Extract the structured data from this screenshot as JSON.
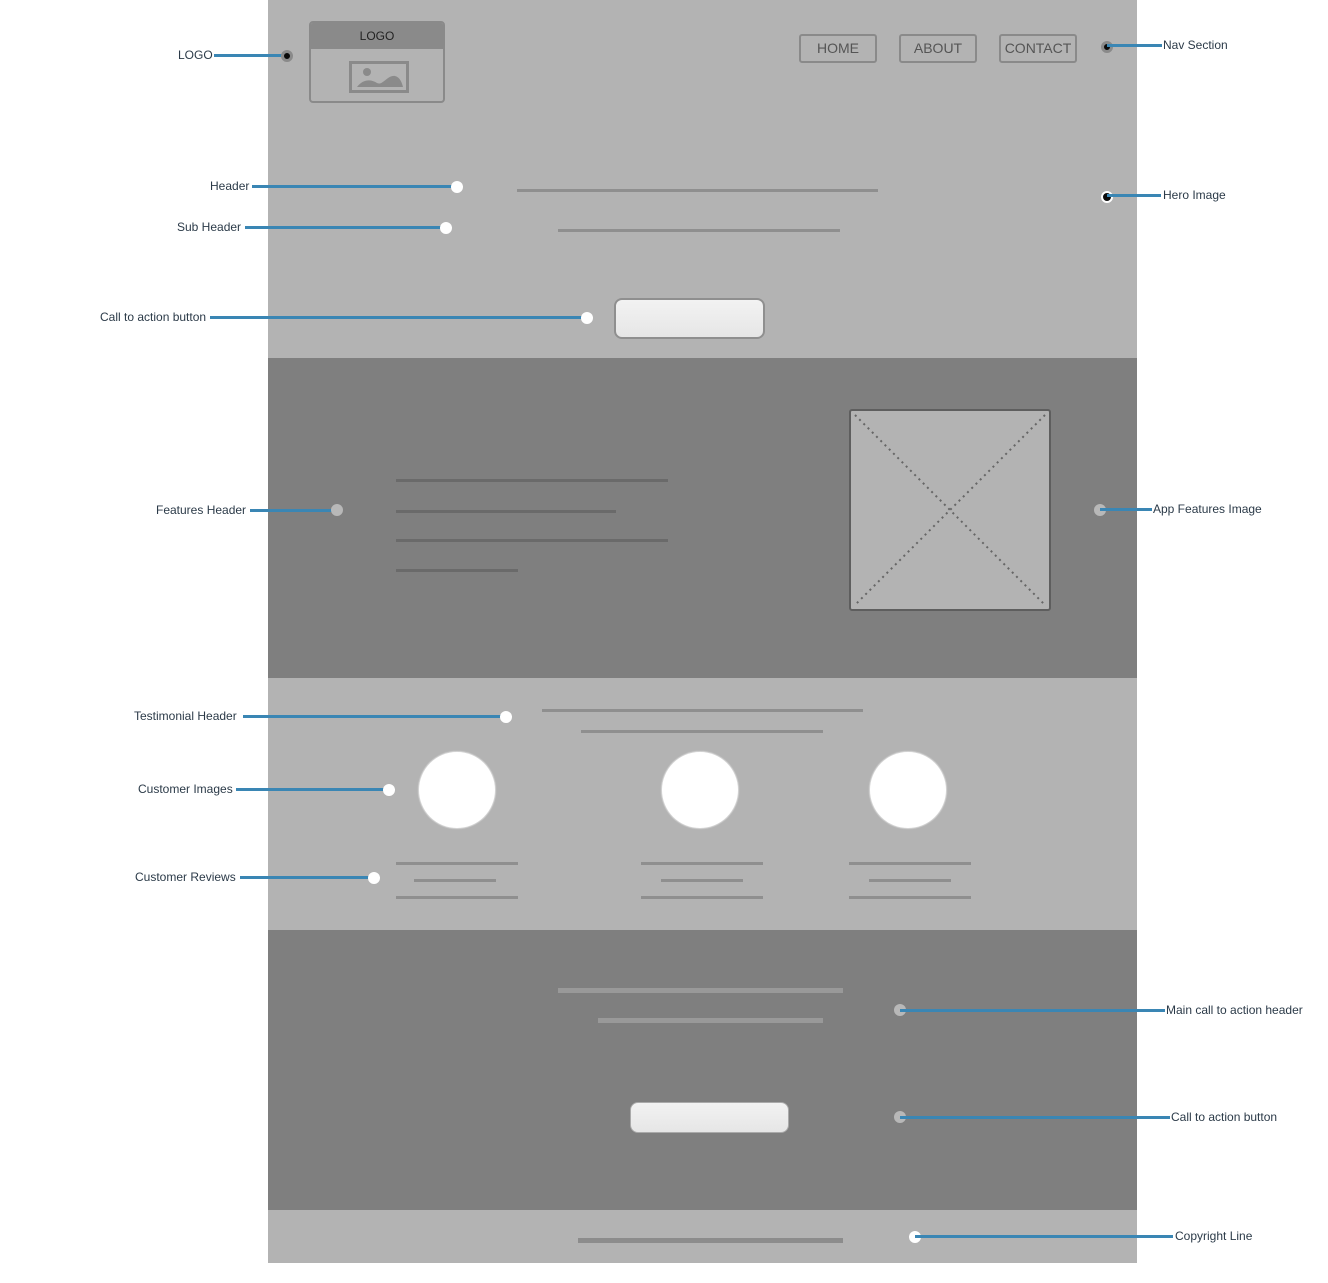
{
  "wireframe": {
    "logo_label": "LOGO",
    "nav": [
      {
        "label": "HOME"
      },
      {
        "label": "ABOUT"
      },
      {
        "label": "CONTACT"
      }
    ],
    "colors": {
      "light_section": "#b3b3b3",
      "dark_section": "#7f7f7f",
      "annotation_line": "#3a86b4",
      "button_fill": "#eeeeee"
    }
  },
  "annotations": {
    "logo": "LOGO",
    "nav_section": "Nav Section",
    "header": "Header",
    "sub_header": "Sub Header",
    "hero_image": "Hero Image",
    "call_to_action_button": "Call to action button",
    "features_header": "Features Header",
    "app_features_image": "App Features Image",
    "testimonial_header": "Testimonial Header",
    "customer_images": "Customer Images",
    "customer_reviews": "Customer Reviews",
    "main_cta_header": "Main call to action header",
    "cta_button_bottom": "Call to action button",
    "copyright_line": "Copyright Line"
  }
}
